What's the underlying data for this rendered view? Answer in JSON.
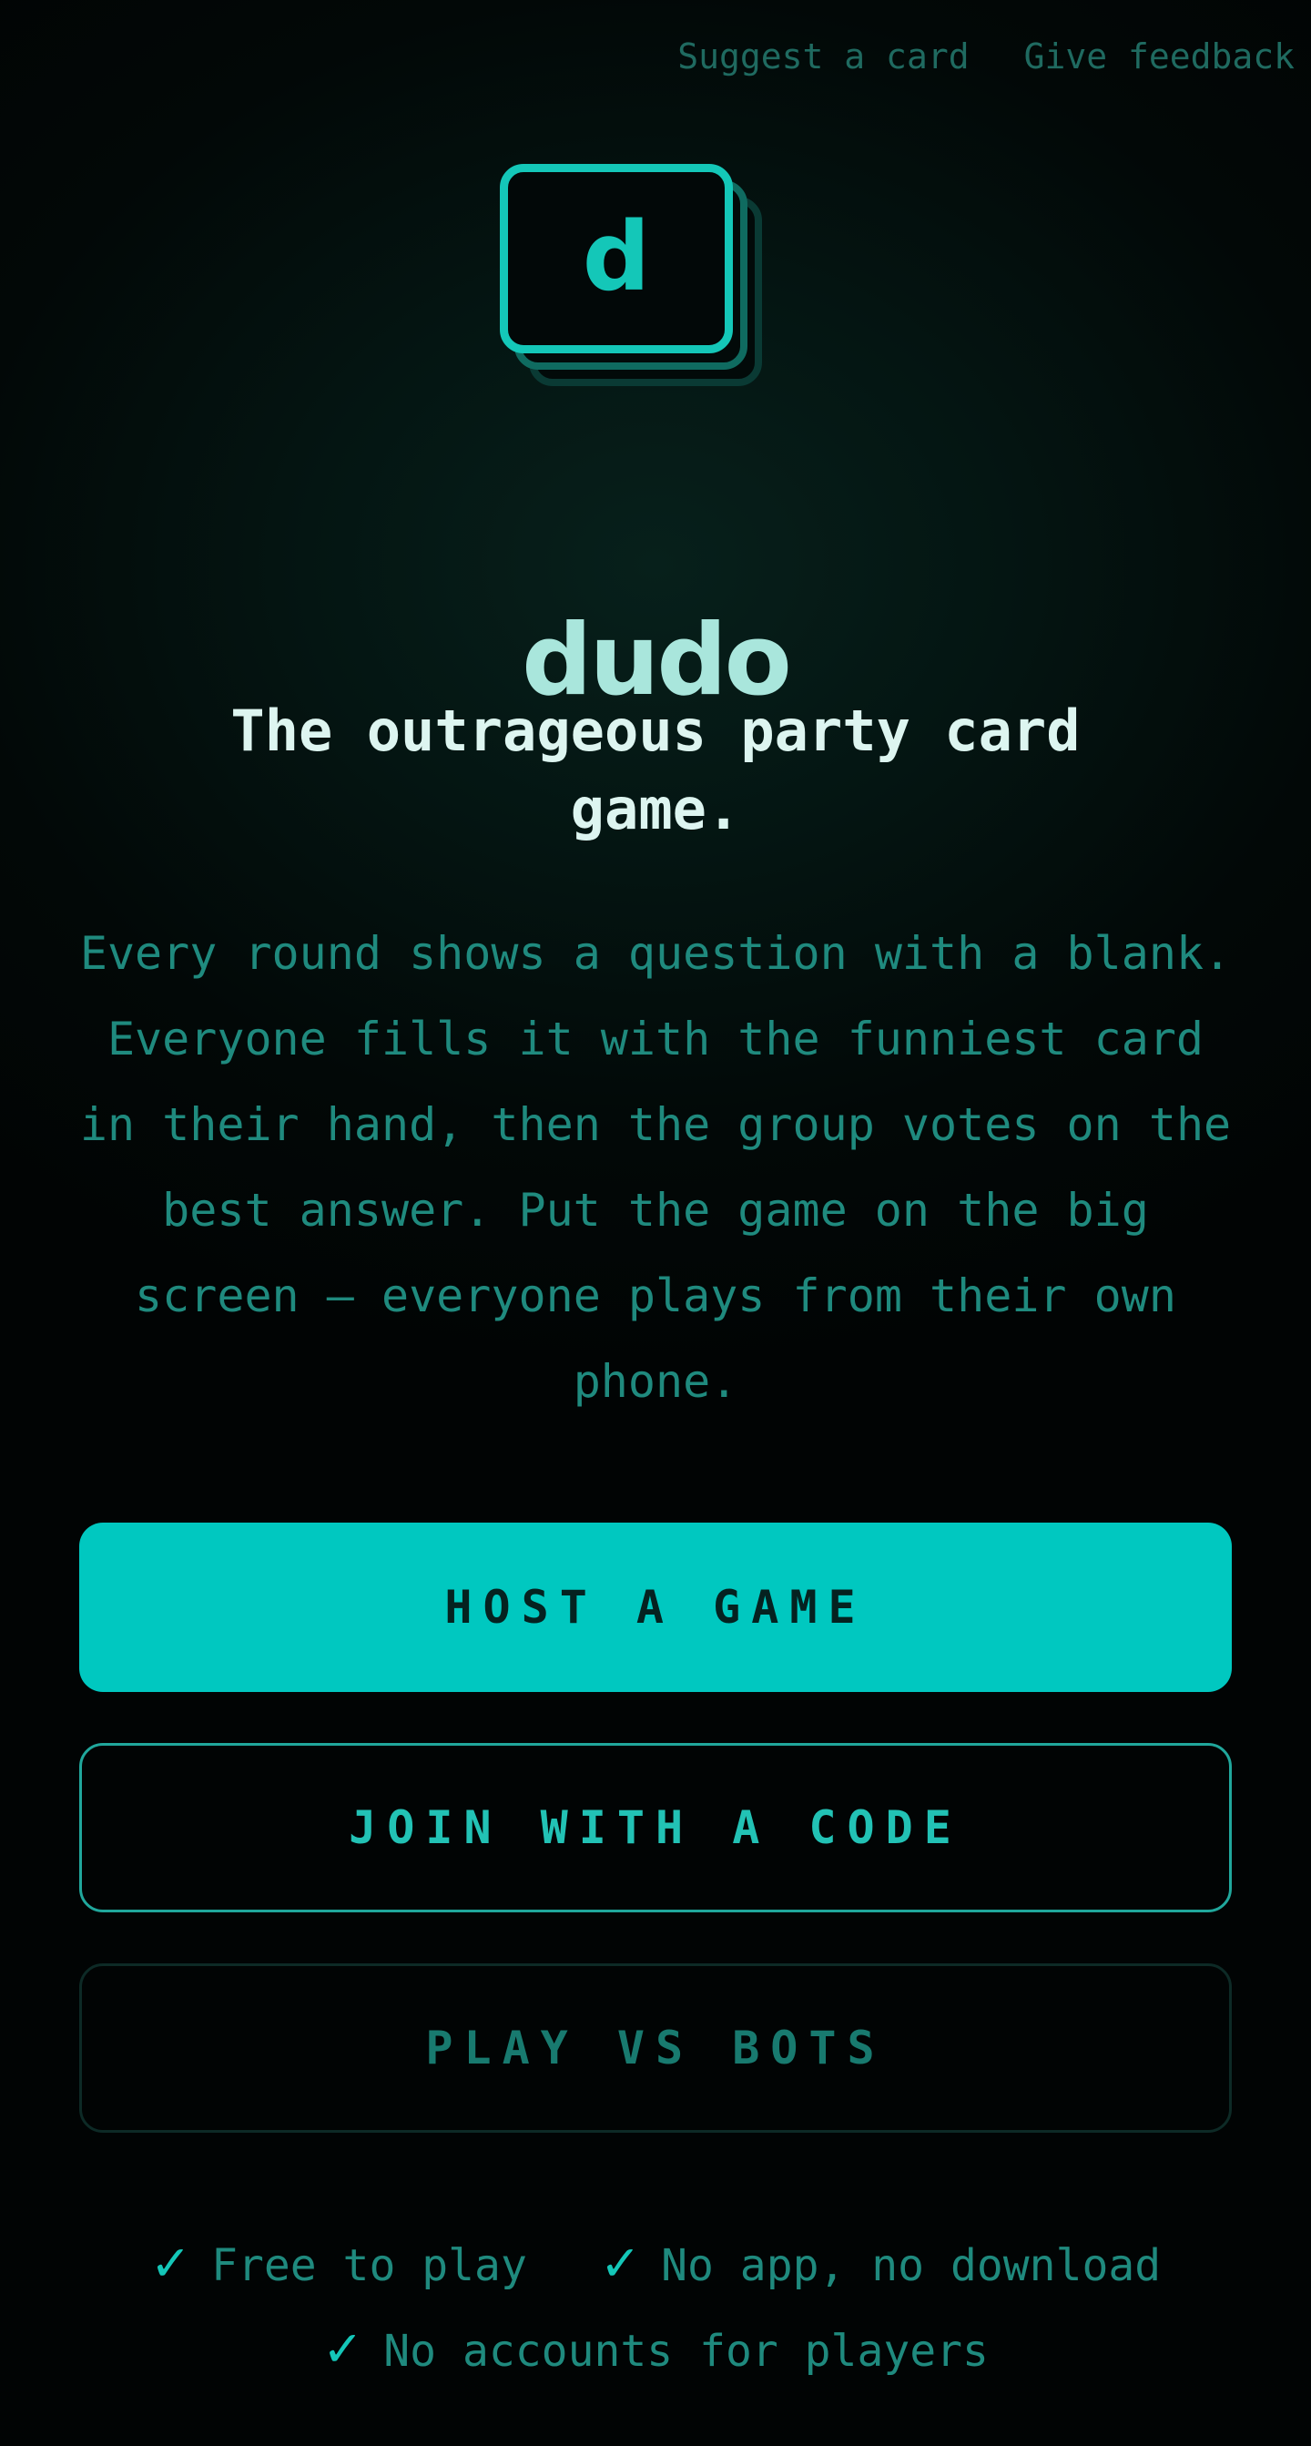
{
  "nav": {
    "suggest_label": "Suggest a card",
    "feedback_label": "Give feedback"
  },
  "logo": {
    "letter": "d"
  },
  "hero": {
    "title": "dudo",
    "tagline": "The outrageous party card game.",
    "description": "Every round shows a question with a blank. Everyone fills it with the funniest card in their hand, then the group votes on the best answer. Put the game on the big screen — everyone plays from their own phone."
  },
  "actions": {
    "host_label": "HOST A GAME",
    "join_label": "JOIN WITH A CODE",
    "bots_label": "PLAY VS BOTS"
  },
  "features": [
    {
      "icon": "check-icon",
      "check": "✓",
      "label": "Free to play"
    },
    {
      "icon": "check-icon",
      "check": "✓",
      "label": "No app, no download"
    },
    {
      "icon": "check-icon",
      "check": "✓",
      "label": "No accounts for players"
    }
  ],
  "colors": {
    "accent": "#00c8c0",
    "background": "#020807",
    "muted_text": "#1f8a7e"
  }
}
